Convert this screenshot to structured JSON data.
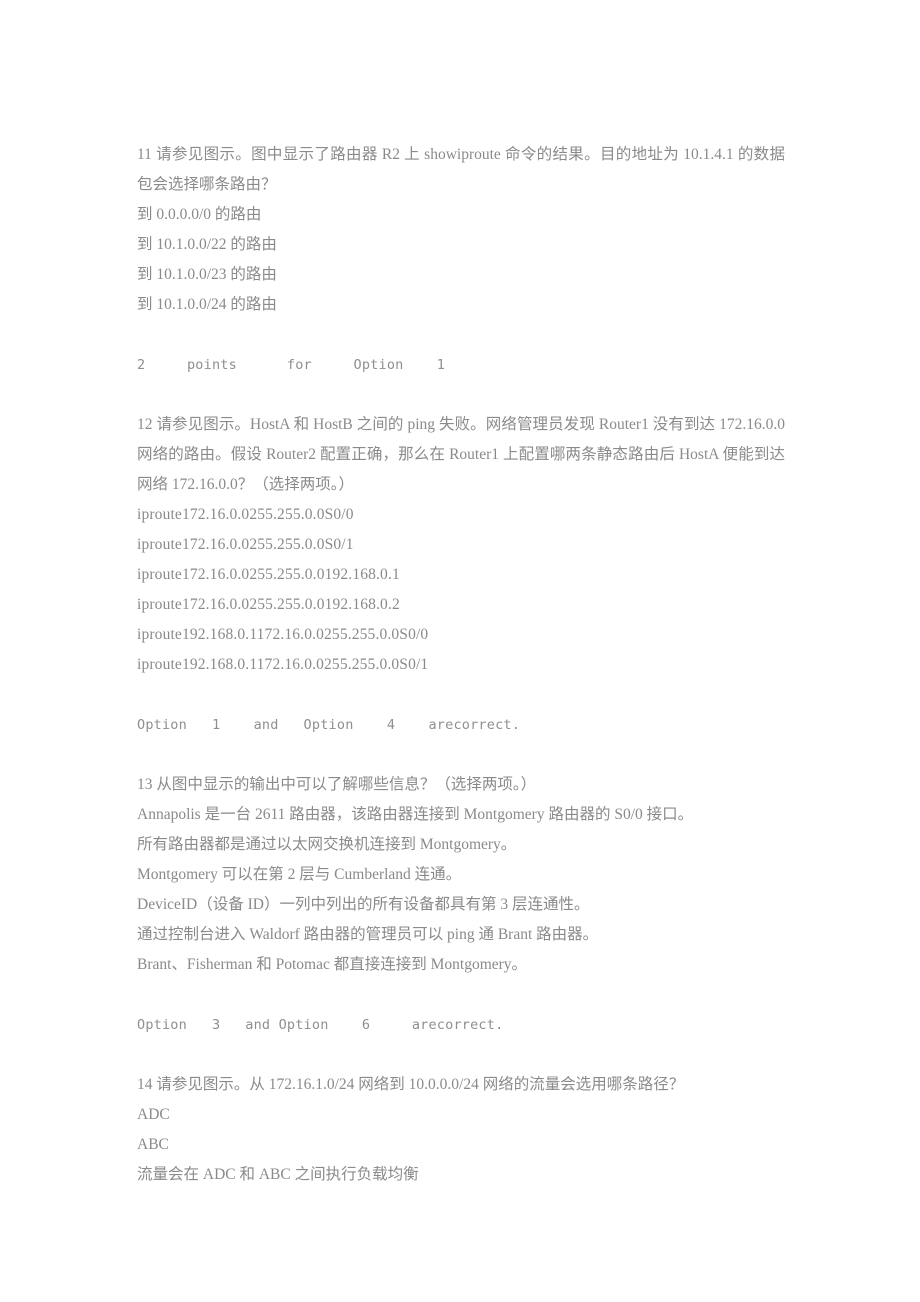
{
  "document": {
    "text_color": "#8a8a8a",
    "background_color": "#ffffff",
    "questions": [
      {
        "number": "11",
        "prompt": "11 请参见图示。图中显示了路由器 R2 上 showiproute 命令的结果。目的地址为 10.1.4.1 的数据包会选择哪条路由？",
        "options": [
          "到 0.0.0.0/0 的路由",
          "到 10.1.0.0/22 的路由",
          "到 10.1.0.0/23 的路由",
          "到 10.1.0.0/24 的路由"
        ],
        "answer_line": "2     points      for     Option    1"
      },
      {
        "number": "12",
        "prompt": "12 请参见图示。HostA 和 HostB 之间的 ping 失败。网络管理员发现 Router1 没有到达 172.16.0.0 网络的路由。假设 Router2 配置正确，那么在 Router1 上配置哪两条静态路由后 HostA 便能到达网络 172.16.0.0？（选择两项。）",
        "options": [
          "iproute172.16.0.0255.255.0.0S0/0",
          "iproute172.16.0.0255.255.0.0S0/1",
          "iproute172.16.0.0255.255.0.0192.168.0.1",
          "iproute172.16.0.0255.255.0.0192.168.0.2",
          "iproute192.168.0.1172.16.0.0255.255.0.0S0/0",
          "iproute192.168.0.1172.16.0.0255.255.0.0S0/1"
        ],
        "answer_line": "Option   1    and   Option    4    arecorrect."
      },
      {
        "number": "13",
        "prompt": "13 从图中显示的输出中可以了解哪些信息？（选择两项。）",
        "options": [
          "Annapolis 是一台 2611 路由器，该路由器连接到 Montgomery 路由器的 S0/0 接口。",
          "所有路由器都是通过以太网交换机连接到 Montgomery。",
          "Montgomery 可以在第 2 层与 Cumberland 连通。",
          "DeviceID（设备 ID）一列中列出的所有设备都具有第 3 层连通性。",
          "通过控制台进入 Waldorf 路由器的管理员可以 ping 通 Brant 路由器。",
          "Brant、Fisherman 和 Potomac 都直接连接到 Montgomery。"
        ],
        "answer_line": "Option   3   and Option    6     arecorrect."
      },
      {
        "number": "14",
        "prompt": "14 请参见图示。从 172.16.1.0/24 网络到 10.0.0.0/24 网络的流量会选用哪条路径？",
        "options": [
          "ADC",
          "ABC",
          "流量会在 ADC 和 ABC 之间执行负载均衡"
        ],
        "answer_line": ""
      }
    ]
  }
}
